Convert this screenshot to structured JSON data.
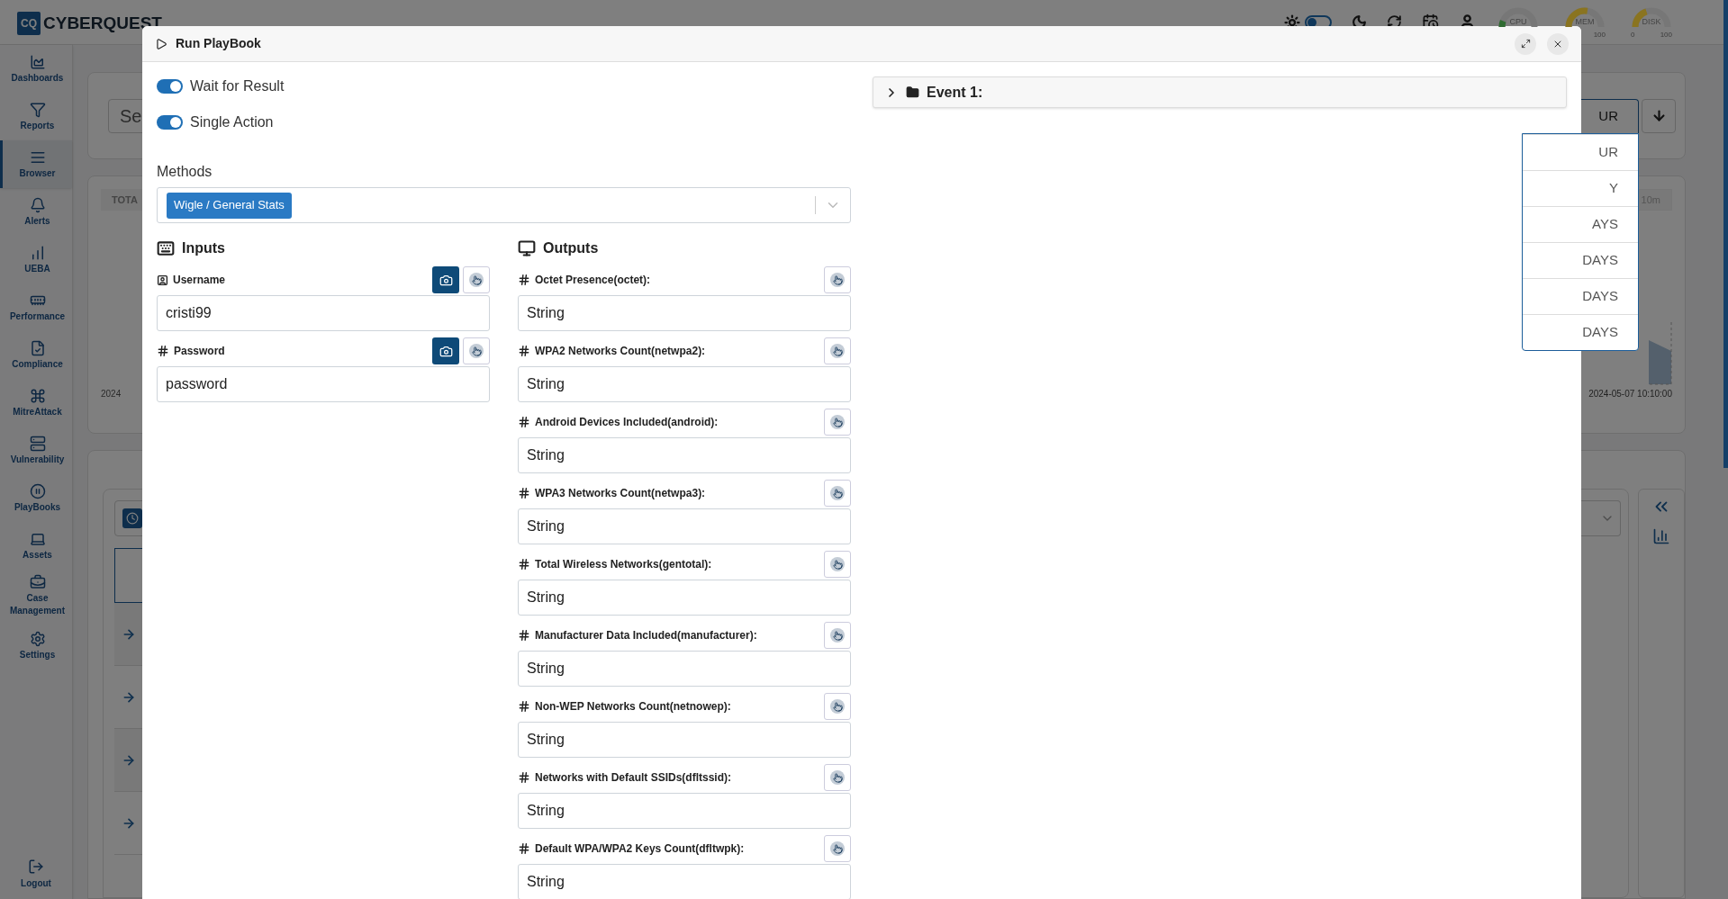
{
  "header": {
    "logo_mark": "CQ",
    "logo_text": "CYBERQUEST",
    "dark_mode": false,
    "gauges": [
      {
        "label": "CPU",
        "level": 0.12,
        "color": "#2f6b31"
      },
      {
        "label": "MEM",
        "max": "100",
        "level": 0.55,
        "color": "#8a7420"
      },
      {
        "label": "DISK",
        "min": "0",
        "max": "100",
        "level": 0.4,
        "color": "#8a7420"
      }
    ]
  },
  "sidebar": {
    "items": [
      {
        "label": "Dashboards",
        "selected": false
      },
      {
        "label": "Reports",
        "selected": false
      },
      {
        "label": "Browser",
        "selected": true
      },
      {
        "label": "Alerts",
        "selected": false
      },
      {
        "label": "UEBA",
        "selected": false
      },
      {
        "label": "Performance",
        "selected": false
      },
      {
        "label": "Compliance",
        "selected": false
      },
      {
        "label": "MitreAttack",
        "selected": false
      },
      {
        "label": "Vulnerability",
        "selected": false
      },
      {
        "label": "PlayBooks",
        "selected": false
      },
      {
        "label": "Assets",
        "selected": false
      },
      {
        "label": "Case Management",
        "selected": false
      },
      {
        "label": "Settings",
        "selected": false
      }
    ],
    "logout": "Logout"
  },
  "background": {
    "search_text": "Se",
    "tab": "TOTA",
    "axis_label": "2024",
    "range_select": {
      "value": "UR",
      "options": [
        "UR",
        "Y",
        "AYS",
        "DAYS",
        "DAYS",
        "DAYS"
      ]
    },
    "interval_badge": "10m",
    "chart_date": "2024-05-07 10:10:00"
  },
  "modal": {
    "title": "Run PlayBook",
    "toggles": [
      {
        "label": "Wait for Result",
        "on": true
      },
      {
        "label": "Single Action",
        "on": true
      }
    ],
    "methods": {
      "label": "Methods",
      "selected": [
        "Wigle / General Stats"
      ]
    },
    "inputs": {
      "heading": "Inputs",
      "fields": [
        {
          "label": "Username",
          "kind": "text",
          "value": "cristi99"
        },
        {
          "label": "Password",
          "kind": "number",
          "value": "password"
        }
      ]
    },
    "outputs": {
      "heading": "Outputs",
      "fields": [
        {
          "label": "Octet Presence(octet):",
          "kind": "number",
          "value": "String"
        },
        {
          "label": "WPA2 Networks Count(netwpa2):",
          "kind": "number",
          "value": "String"
        },
        {
          "label": "Android Devices Included(android):",
          "kind": "number",
          "value": "String"
        },
        {
          "label": "WPA3 Networks Count(netwpa3):",
          "kind": "number",
          "value": "String"
        },
        {
          "label": "Total Wireless Networks(gentotal):",
          "kind": "number",
          "value": "String"
        },
        {
          "label": "Manufacturer Data Included(manufacturer):",
          "kind": "number",
          "value": "String"
        },
        {
          "label": "Non-WEP Networks Count(netnowep):",
          "kind": "number",
          "value": "String"
        },
        {
          "label": "Networks with Default SSIDs(dfltssid):",
          "kind": "number",
          "value": "String"
        },
        {
          "label": "Default WPA/WPA2 Keys Count(dfltwpk):",
          "kind": "number",
          "value": "String"
        }
      ]
    },
    "event": {
      "label": "Event 1:",
      "expanded": false
    }
  }
}
